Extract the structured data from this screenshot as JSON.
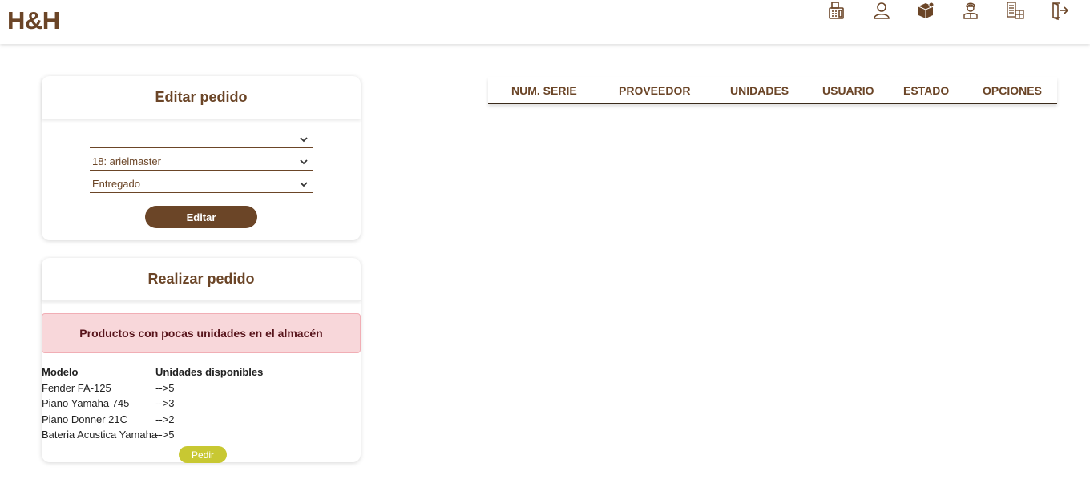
{
  "brand": {
    "logo": "H&H",
    "color": "#6b4527"
  },
  "nav": {
    "icons": [
      "cash-register-icon",
      "user-icon",
      "box-icon",
      "employee-icon",
      "stock-icon",
      "logout-icon"
    ]
  },
  "edit_order": {
    "title": "Editar pedido",
    "selects": [
      {
        "value": ""
      },
      {
        "value": "18: arielmaster"
      },
      {
        "value": "Entregado"
      }
    ],
    "button_label": "Editar"
  },
  "place_order": {
    "title": "Realizar pedido",
    "alert": "Productos con pocas unidades en el almacén",
    "columns": [
      "Modelo",
      "Unidades disponibles"
    ],
    "rows": [
      {
        "model": "Fender FA-125",
        "units": "-->5"
      },
      {
        "model": "Piano Yamaha 745",
        "units": "-->3"
      },
      {
        "model": "Piano Donner 21C",
        "units": "-->2"
      },
      {
        "model": "Bateria Acustica Yamaha",
        "units": "-->5"
      }
    ],
    "button_label": "Pedir",
    "button_color": "#c8c832"
  },
  "orders_table": {
    "headers": [
      "NUM. SERIE",
      "PROVEEDOR",
      "UNIDADES",
      "USUARIO",
      "ESTADO",
      "OPCIONES"
    ]
  }
}
